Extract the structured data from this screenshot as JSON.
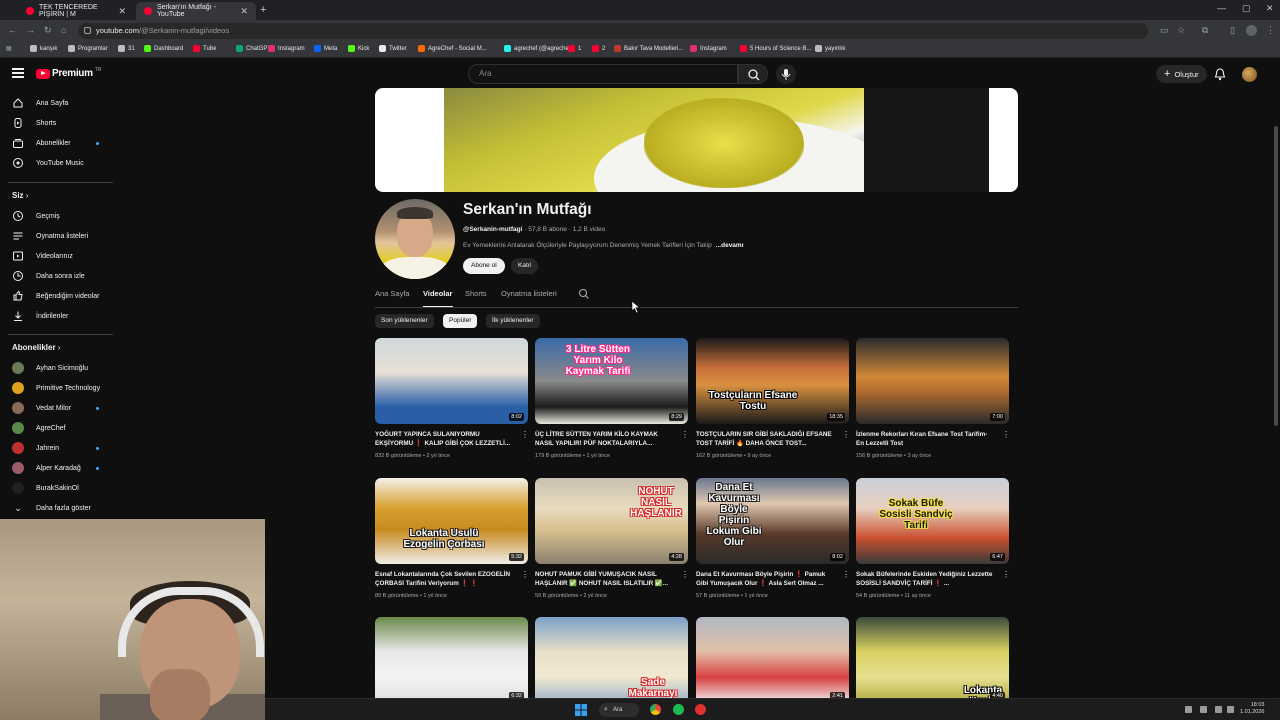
{
  "browser": {
    "tabs": [
      {
        "title": "TEK TENCEREDE PİŞİRİN | M",
        "active": false
      },
      {
        "title": "Serkan'ın Mutfağı - YouTube",
        "active": true
      }
    ],
    "url_host": "youtube.com",
    "url_path": "/@Serkanin-mutfagi/videos",
    "bookmarks": [
      {
        "label": "kanşık",
        "icon": "folder-icon"
      },
      {
        "label": "Programlar",
        "icon": "folder-icon"
      },
      {
        "label": "31",
        "icon": "folder-icon"
      },
      {
        "label": "Dashboard",
        "icon": "kick-icon"
      },
      {
        "label": "Tube",
        "icon": "youtube-icon"
      },
      {
        "label": "ChatGPT",
        "icon": "chatgpt-icon"
      },
      {
        "label": "Instagram",
        "icon": "instagram-icon"
      },
      {
        "label": "Meta",
        "icon": "meta-icon"
      },
      {
        "label": "Kick",
        "icon": "kick-icon"
      },
      {
        "label": "Twitter",
        "icon": "x-icon"
      },
      {
        "label": "AgreChef - Social M...",
        "icon": "social-icon"
      },
      {
        "label": "agrechef (@agreche...",
        "icon": "tiktok-icon"
      },
      {
        "label": "1",
        "icon": "youtube-icon"
      },
      {
        "label": "2",
        "icon": "youtube-icon"
      },
      {
        "label": "Bakır Tava Modelleri...",
        "icon": "bakir-icon"
      },
      {
        "label": "Instagram",
        "icon": "instagram-icon"
      },
      {
        "label": "5 Hours of Science B...",
        "icon": "youtube-icon"
      },
      {
        "label": "yayınlık",
        "icon": "folder-icon"
      }
    ]
  },
  "masthead": {
    "logo": "Premium",
    "logo_country": "TR",
    "search_placeholder": "Ara",
    "create_label": "Oluştur"
  },
  "sidebar": {
    "main": [
      {
        "label": "Ana Sayfa",
        "icon": "home-icon",
        "dot": false
      },
      {
        "label": "Shorts",
        "icon": "shorts-icon",
        "dot": false
      },
      {
        "label": "Abonelikler",
        "icon": "subscriptions-icon",
        "dot": true
      },
      {
        "label": "YouTube Music",
        "icon": "music-icon",
        "dot": false
      }
    ],
    "you_heading": "Siz",
    "you": [
      {
        "label": "Geçmiş",
        "icon": "history-icon"
      },
      {
        "label": "Oynatma listeleri",
        "icon": "playlist-icon"
      },
      {
        "label": "Videolarınız",
        "icon": "your-videos-icon"
      },
      {
        "label": "Daha sonra izle",
        "icon": "watch-later-icon"
      },
      {
        "label": "Beğendiğim videolar",
        "icon": "like-icon"
      },
      {
        "label": "İndirilenler",
        "icon": "download-icon"
      }
    ],
    "subs_heading": "Abonelikler",
    "subscriptions": [
      {
        "label": "Ayhan Sicimoğlu",
        "color": "#6a7a5a",
        "dot": false
      },
      {
        "label": "Primitive Technology",
        "color": "#e0a020",
        "dot": false
      },
      {
        "label": "Vedat Milor",
        "color": "#8a6a5a",
        "dot": true
      },
      {
        "label": "AgreChef",
        "color": "#5a8a4a",
        "dot": false
      },
      {
        "label": "Jahrein",
        "color": "#c03030",
        "dot": true
      },
      {
        "label": "Alper Karadağ",
        "color": "#9a5a6a",
        "dot": true
      },
      {
        "label": "BurakSakinOl",
        "color": "#202020",
        "dot": false
      }
    ],
    "show_more": "Daha fazla göster"
  },
  "channel": {
    "name": "Serkan'ın Mutfağı",
    "handle": "@Serkanin-mutfagi",
    "subscribers": "57,8 B abone",
    "videos": "1,2 B video",
    "description": "Ev Yemeklerini Anlatarak Ölçüleriyle Paylaşıyorum Denenmiş Yemek Tarifleri İçin Takip",
    "more": "...devamı",
    "subscribe_label": "Abone ol",
    "join_label": "Katıl",
    "tabs": [
      "Ana Sayfa",
      "Videolar",
      "Shorts",
      "Oynatma listeleri"
    ],
    "active_tab": "Videolar"
  },
  "chips": [
    "Son yüklenenler",
    "Popüler",
    "İlk yüklenenler"
  ],
  "selected_chip": "Popüler",
  "videos": [
    {
      "title": "YOĞURT YAPINCA SULANIYORMU EKŞİYORMU ❗ KALIP GİBİ ÇOK LEZZETLİ...",
      "views": "832 B görüntüleme",
      "age": "2 yıl önce",
      "duration": "8:02",
      "caption": ""
    },
    {
      "title": "ÜÇ LİTRE SÜTTEN YARIM KİLO KAYMAK NASIL YAPILIR! PÜF NOKTALARIYLA...",
      "views": "179 B görüntüleme",
      "age": "1 yıl önce",
      "duration": "8:29",
      "caption": "3 Litre Sütten Yarım Kilo Kaymak Tarifi"
    },
    {
      "title": "TOSTÇULARIN SIR GİBİ SAKLADIĞI EFSANE TOST TARİFİ 🔥 DAHA ÖNCE TOST...",
      "views": "162 B görüntüleme",
      "age": "9 ay önce",
      "duration": "18:35",
      "caption": "Tostçuların Efsane Tostu"
    },
    {
      "title": "İzlenme Rekorları Kıran Efsane Tost Tarifim- En Lezzetli Tost",
      "views": "156 B görüntüleme",
      "age": "3 ay önce",
      "duration": "7:00",
      "caption": ""
    },
    {
      "title": "Esnaf Lokantalarında Çok Sevilen EZOGELİN ÇORBASI Tarifini Veriyorum ❗ ❗",
      "views": "89 B görüntüleme",
      "age": "1 yıl önce",
      "duration": "5:32",
      "caption": "Lokanta Usulü Ezogelin Çorbası"
    },
    {
      "title": "NOHUT PAMUK GİBİ YUMUŞACIK NASIL HAŞLANIR ✅ NOHUT NASIL ISLATILIR ✅...",
      "views": "59 B görüntüleme",
      "age": "2 yıl önce",
      "duration": "4:28",
      "caption": "NOHUT NASIL HAŞLANIR"
    },
    {
      "title": "Dana Et Kavurması Böyle Pişirin ❗ Pamuk Gibi Yumuşacık Olur ❗ Asla Sert Olmaz ...",
      "views": "57 B görüntüleme",
      "age": "1 yıl önce",
      "duration": "8:02",
      "caption": "Dana Et Kavurması Böyle Pişirin Lokum Gibi Olur"
    },
    {
      "title": "Sokak Büfelerinde Eskiden Yediğiniz Lezzette SOSİSLİ SANDVİÇ TARİFİ ❗ ...",
      "views": "54 B görüntüleme",
      "age": "11 ay önce",
      "duration": "6:47",
      "caption": "Sokak Büfe Sosisli Sandviç Tarifi"
    },
    {
      "title": "",
      "views": "",
      "age": "",
      "duration": "6:32",
      "caption": ""
    },
    {
      "title": "",
      "views": "",
      "age": "",
      "duration": "",
      "caption": "Sade Makarnayı Böyle Pişirin"
    },
    {
      "title": "",
      "views": "",
      "age": "",
      "duration": "2:41",
      "caption": ""
    },
    {
      "title": "",
      "views": "",
      "age": "",
      "duration": "4:40",
      "caption": "Lokanta Usulü Tavuk Ha..."
    }
  ],
  "taskbar": {
    "search_label": "Ara",
    "time": "18:03",
    "date": "1.01.2026"
  }
}
